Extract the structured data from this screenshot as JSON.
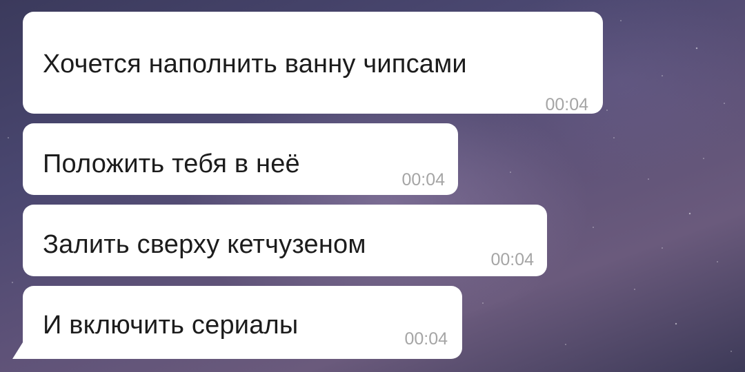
{
  "messages": [
    {
      "text": "Хочется наполнить ванну чипсами",
      "time": "00:04"
    },
    {
      "text": "Положить тебя в неё",
      "time": "00:04"
    },
    {
      "text": "Залить сверху кетчузеном",
      "time": "00:04"
    },
    {
      "text": "И включить сериалы",
      "time": "00:04"
    }
  ],
  "colors": {
    "bubble": "#ffffff",
    "text": "#1c1c1c",
    "time": "#a5a5a5"
  }
}
